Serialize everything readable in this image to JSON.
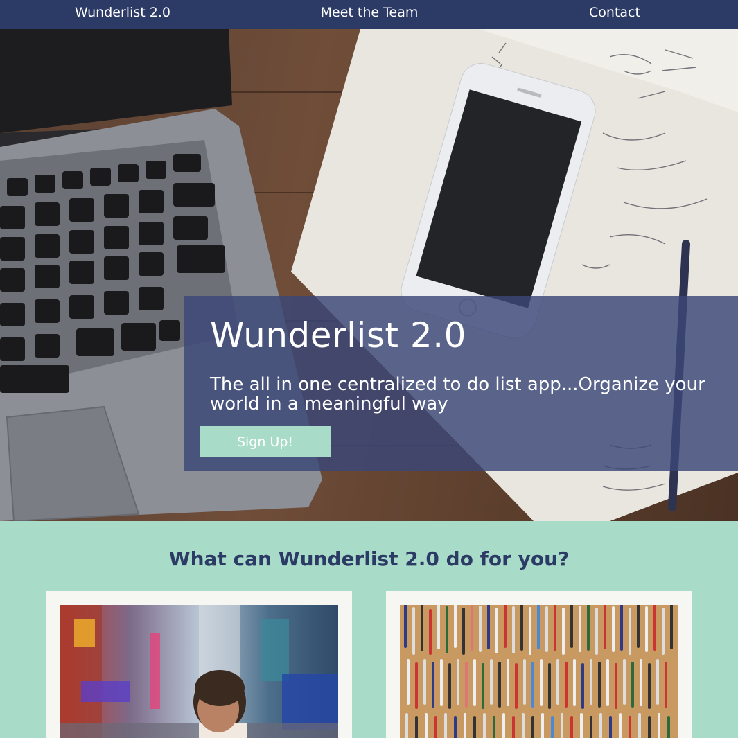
{
  "nav": {
    "items": [
      {
        "label": "Wunderlist 2.0"
      },
      {
        "label": "Meet the Team"
      },
      {
        "label": "Contact"
      }
    ]
  },
  "hero": {
    "title": "Wunderlist 2.0",
    "subtitle": "The all in one centralized to do list app...Organize your world in a meaningful way",
    "signup_label": "Sign Up!"
  },
  "features": {
    "heading": "What can Wunderlist 2.0 do for you?"
  },
  "colors": {
    "nav_bg": "#2c3a66",
    "accent": "#a8dcc8",
    "overlay": "#3a4778",
    "heading_text": "#2c3a66"
  }
}
